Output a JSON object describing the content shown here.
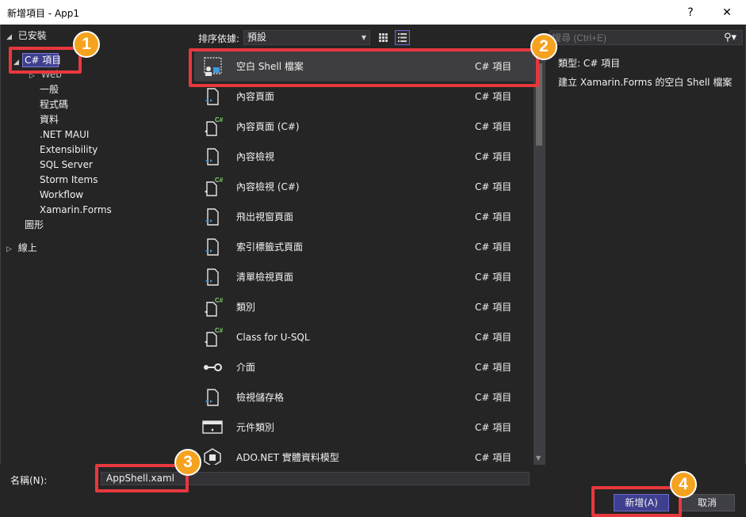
{
  "window": {
    "title": "新增項目 - App1",
    "help": "?",
    "close": "✕"
  },
  "tree": {
    "installed": "已安裝",
    "selected": "C# 項目",
    "web": "Web",
    "children": [
      "一般",
      "程式碼",
      "資料",
      ".NET MAUI",
      "Extensibility",
      "SQL Server",
      "Storm Items",
      "Workflow",
      "Xamarin.Forms"
    ],
    "graphics": "圖形",
    "online": "線上"
  },
  "toolbar": {
    "sort_label": "排序依據:",
    "sort_value": "預設"
  },
  "items": [
    {
      "name": "空白 Shell 檔案",
      "lang": "C# 項目",
      "icon": "shell-file-icon"
    },
    {
      "name": "內容頁面",
      "lang": "C# 項目",
      "icon": "xaml-page-icon"
    },
    {
      "name": "內容頁面 (C#)",
      "lang": "C# 項目",
      "icon": "csharp-page-icon"
    },
    {
      "name": "內容檢視",
      "lang": "C# 項目",
      "icon": "xaml-page-icon"
    },
    {
      "name": "內容檢視 (C#)",
      "lang": "C# 項目",
      "icon": "csharp-page-icon"
    },
    {
      "name": "飛出視窗頁面",
      "lang": "C# 項目",
      "icon": "xaml-page-icon"
    },
    {
      "name": "索引標籤式頁面",
      "lang": "C# 項目",
      "icon": "xaml-page-icon"
    },
    {
      "name": "清單檢視頁面",
      "lang": "C# 項目",
      "icon": "xaml-page-icon"
    },
    {
      "name": "類別",
      "lang": "C# 項目",
      "icon": "csharp-page-icon"
    },
    {
      "name": "Class for U-SQL",
      "lang": "C# 項目",
      "icon": "csharp-page-icon"
    },
    {
      "name": "介面",
      "lang": "C# 項目",
      "icon": "interface-icon"
    },
    {
      "name": "檢視儲存格",
      "lang": "C# 項目",
      "icon": "xaml-page-icon"
    },
    {
      "name": "元件類別",
      "lang": "C# 項目",
      "icon": "component-class-icon"
    },
    {
      "name": "ADO.NET 實體資料模型",
      "lang": "C# 項目",
      "icon": "ado-model-icon"
    }
  ],
  "search": {
    "placeholder": "搜尋 (Ctrl+E)"
  },
  "details": {
    "type": "類型:  C# 項目",
    "description": "建立 Xamarin.Forms 的空白 Shell 檔案"
  },
  "bottom": {
    "name_label": "名稱(N):",
    "name_value": "AppShell.xaml",
    "add": "新增(A)",
    "cancel": "取消"
  },
  "callouts": [
    "1",
    "2",
    "3",
    "4"
  ],
  "colors": {
    "accent": "#3f3f8f",
    "callout_border": "#e8383d",
    "callout_badge": "#f5a21f",
    "csharp_green": "#7fd36b",
    "xaml_blue": "#3b9ae1"
  }
}
